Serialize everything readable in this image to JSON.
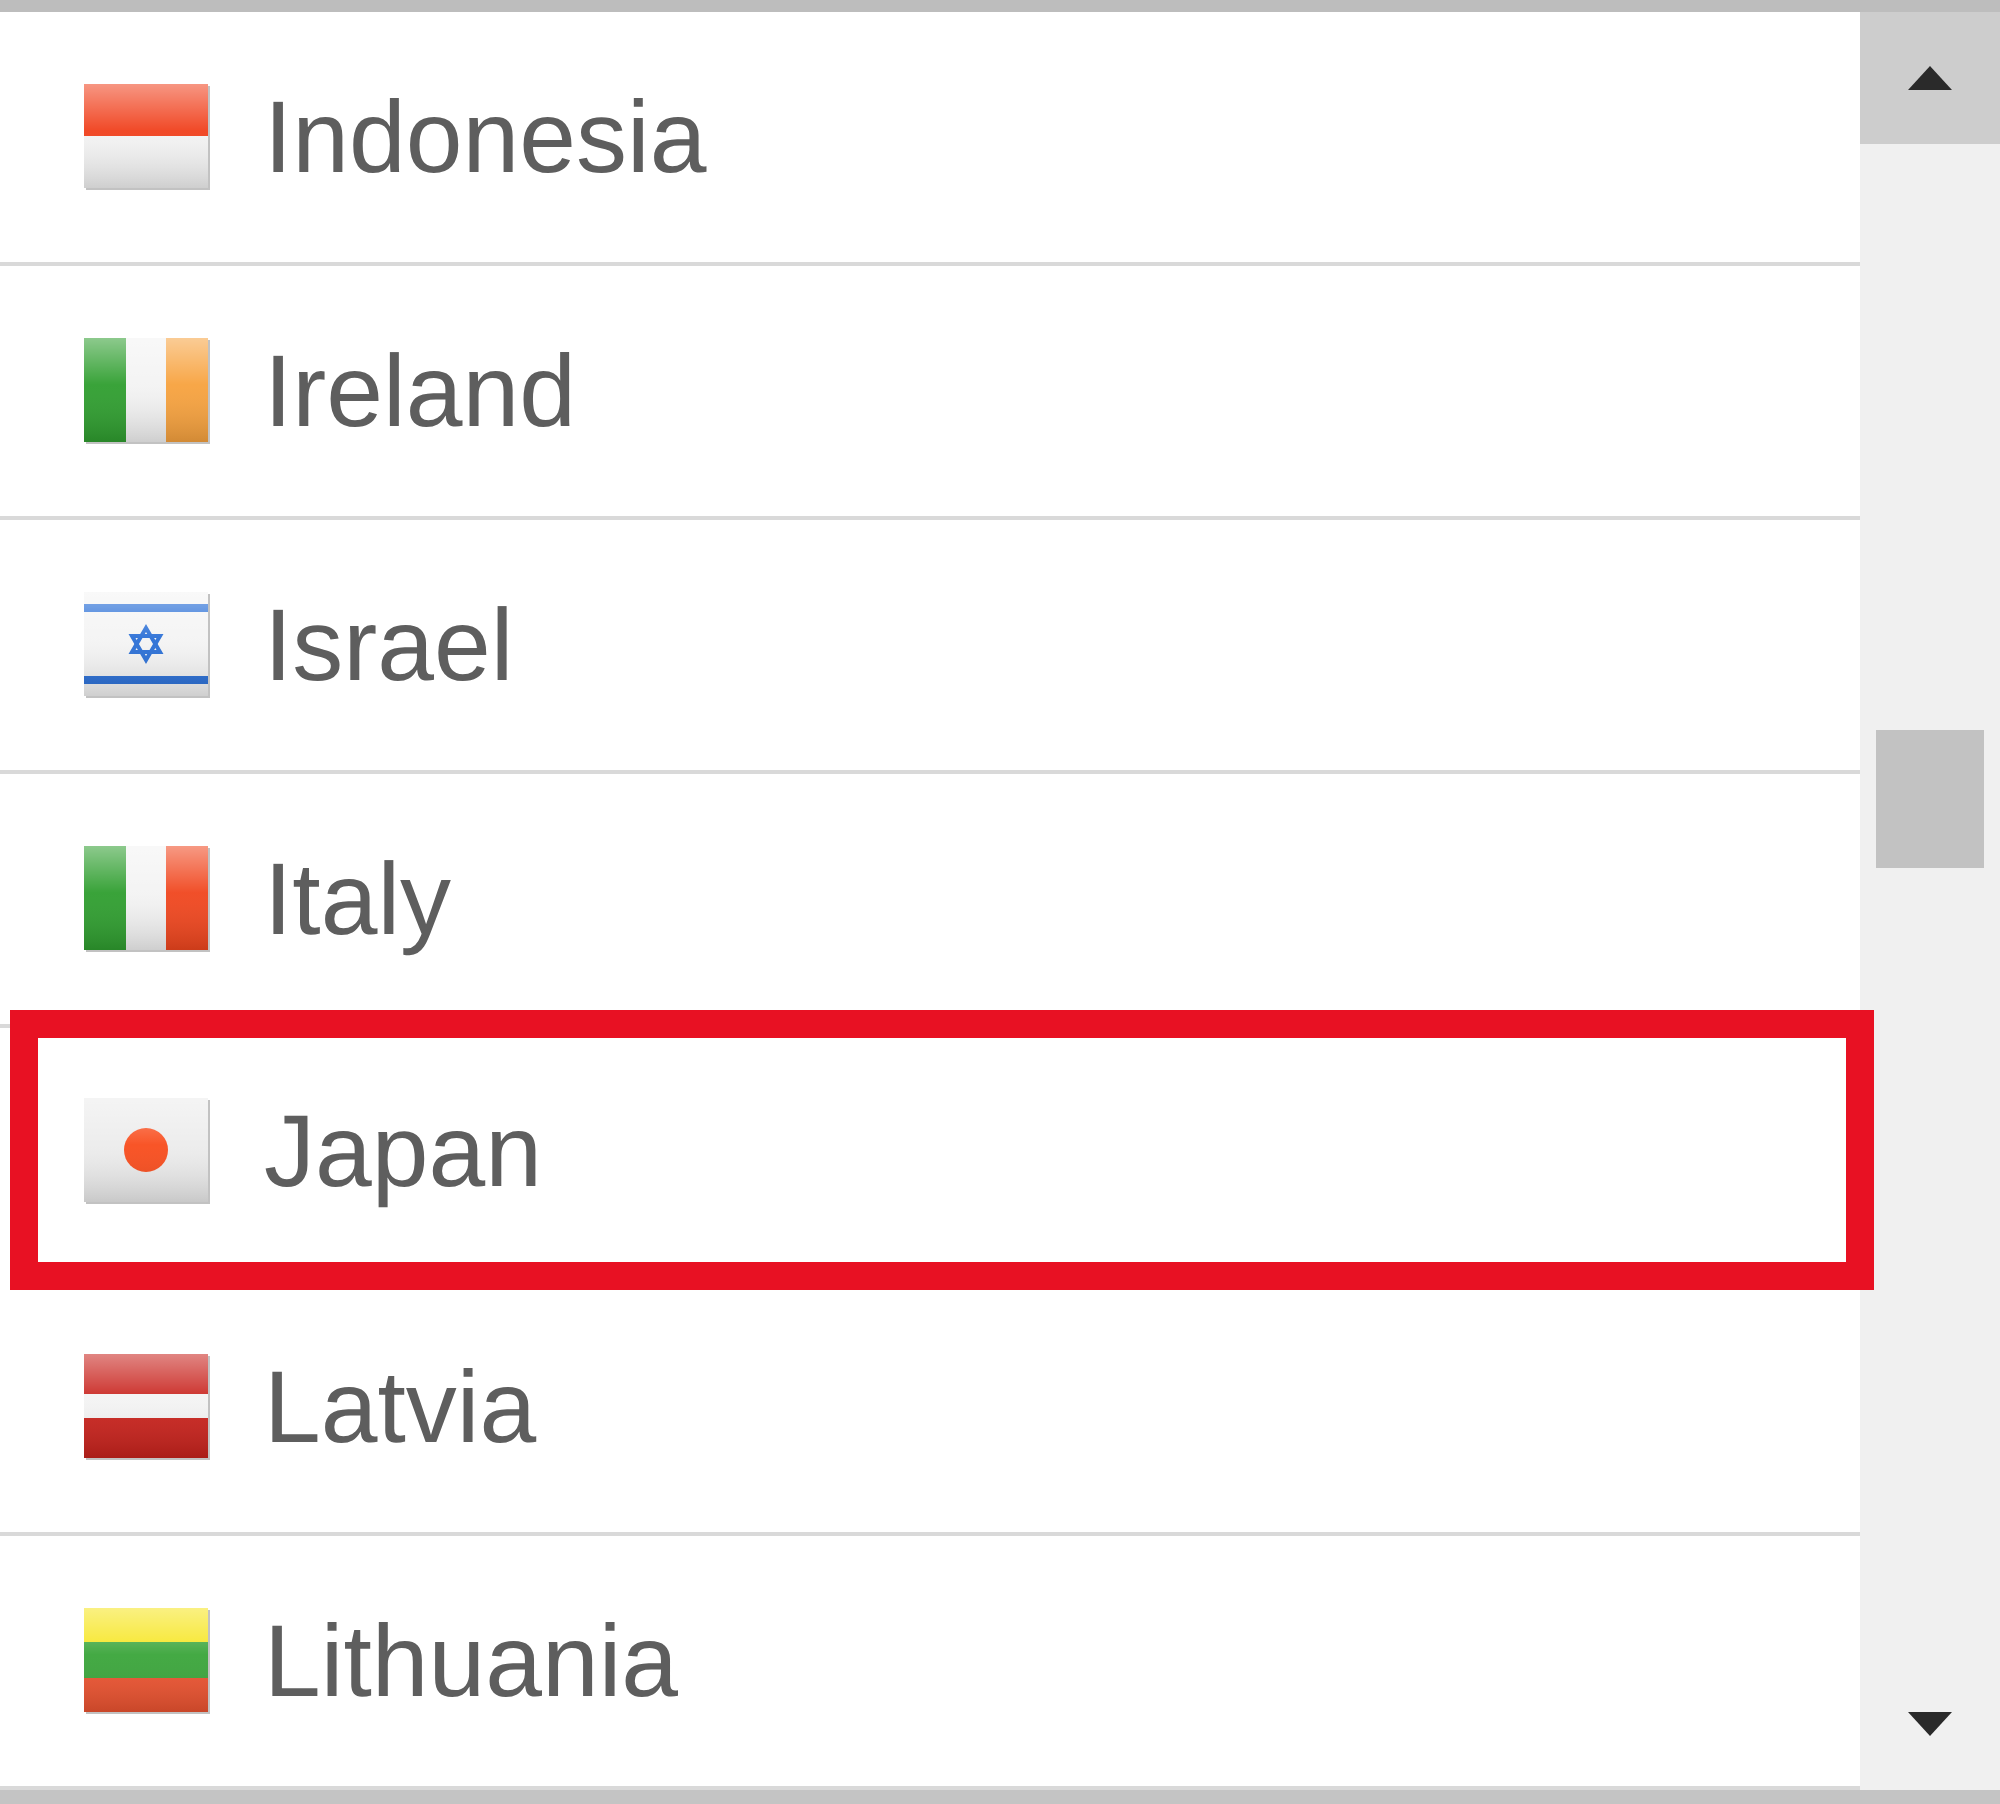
{
  "list": {
    "items": [
      {
        "name": "Indonesia",
        "kind": "indonesia",
        "selected": false
      },
      {
        "name": "Ireland",
        "kind": "ireland",
        "selected": false
      },
      {
        "name": "Israel",
        "kind": "israel",
        "selected": false
      },
      {
        "name": "Italy",
        "kind": "italy",
        "selected": false
      },
      {
        "name": "Japan",
        "kind": "japan",
        "selected": true
      },
      {
        "name": "Latvia",
        "kind": "latvia",
        "selected": false
      },
      {
        "name": "Lithuania",
        "kind": "lithuania",
        "selected": false
      }
    ]
  }
}
